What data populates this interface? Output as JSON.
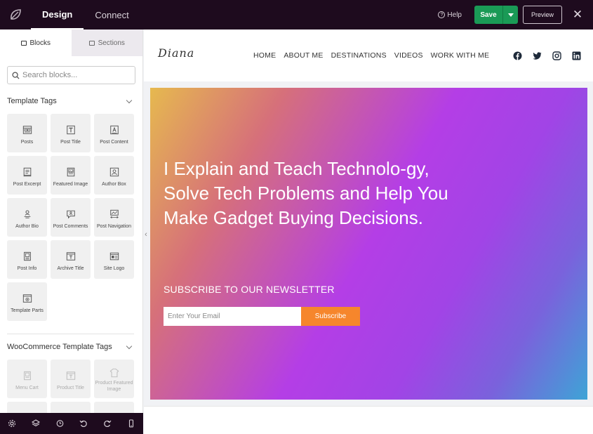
{
  "topbar": {
    "tabs": [
      {
        "label": "Design",
        "active": true
      },
      {
        "label": "Connect",
        "active": false
      }
    ],
    "help_label": "Help",
    "save_label": "Save",
    "preview_label": "Preview",
    "close_glyph": "✕",
    "colors": {
      "bar": "#1e0b1e",
      "save": "#1a9a56"
    }
  },
  "sidebar": {
    "tabs": [
      {
        "label": "Blocks",
        "active": true
      },
      {
        "label": "Sections",
        "active": false
      }
    ],
    "search_placeholder": "Search blocks...",
    "groups": [
      {
        "title": "Template Tags",
        "items": [
          {
            "label": "Posts",
            "icon": "posts-icon"
          },
          {
            "label": "Post Title",
            "icon": "post-title-icon"
          },
          {
            "label": "Post Content",
            "icon": "post-content-icon"
          },
          {
            "label": "Post Excerpt",
            "icon": "post-excerpt-icon"
          },
          {
            "label": "Featured Image",
            "icon": "featured-image-icon"
          },
          {
            "label": "Author Box",
            "icon": "author-box-icon"
          },
          {
            "label": "Author Bio",
            "icon": "author-bio-icon"
          },
          {
            "label": "Post Comments",
            "icon": "post-comments-icon"
          },
          {
            "label": "Post Navigation",
            "icon": "post-navigation-icon"
          },
          {
            "label": "Post Info",
            "icon": "post-info-icon"
          },
          {
            "label": "Archive Title",
            "icon": "archive-title-icon"
          },
          {
            "label": "Site Logo",
            "icon": "site-logo-icon"
          },
          {
            "label": "Template Parts",
            "icon": "template-parts-icon"
          }
        ]
      },
      {
        "title": "WooCommerce Template Tags",
        "items": [
          {
            "label": "Menu Cart",
            "icon": "menu-cart-icon"
          },
          {
            "label": "Product Title",
            "icon": "product-title-icon"
          },
          {
            "label": "Product Featured Image",
            "icon": "product-featured-image-icon"
          }
        ]
      }
    ]
  },
  "bottom_toolbar": [
    "settings-icon",
    "layers-icon",
    "history-icon",
    "undo-icon",
    "redo-icon",
    "mobile-preview-icon"
  ],
  "site": {
    "logo_text": "Diana",
    "nav": [
      "HOME",
      "ABOUT ME",
      "DESTINATIONS",
      "VIDEOS",
      "WORK WITH ME"
    ],
    "social": [
      "facebook-icon",
      "twitter-icon",
      "instagram-icon",
      "linkedin-icon"
    ],
    "hero": {
      "title": "I Explain and Teach Technolo-gy, Solve Tech Problems and Help You Make Gadget Buying Decisions.",
      "subscribe_title": "SUBSCRIBE TO OUR NEWSLETTER",
      "email_placeholder": "Enter Your Email",
      "button_label": "Subscribe",
      "button_color": "#f6862c"
    }
  }
}
